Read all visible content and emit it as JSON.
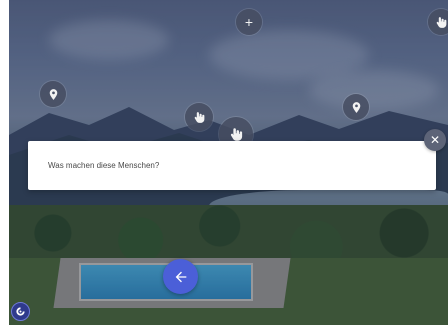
{
  "question": {
    "text": "Was machen diese Menschen?"
  },
  "controls": {
    "add_glyph": "+",
    "close_glyph": "✕"
  },
  "icons": {
    "add": "plus-icon",
    "pins": [
      "location-pin-icon",
      "location-pin-icon"
    ],
    "hands": [
      "hand-pointer-icon",
      "hand-pointer-icon",
      "hand-pointer-icon"
    ],
    "close": "close-icon",
    "back": "arrow-left-icon",
    "logo": "brand-logo-icon"
  },
  "colors": {
    "accent": "#4b5fd8",
    "overlay_button": "#464e62",
    "card_bg": "#ffffff"
  }
}
